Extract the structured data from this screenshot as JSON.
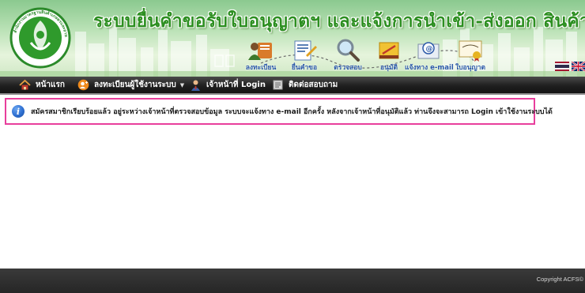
{
  "header": {
    "site_title": "ระบบยื่นคำขอรับใบอนุญาตฯ และแจ้งการนำเข้า-ส่งออก สินค้าเกษตรตามมาตรฐานบังคับ",
    "logo_caption": "สำนักงานมาตรฐานสินค้าเกษตรและอาหารแห่งชาติ",
    "menu_items": [
      {
        "label": "ลงทะเบียน",
        "icon": "register-user-icon"
      },
      {
        "label": "ยื่นคำขอ",
        "icon": "submit-document-icon"
      },
      {
        "label": "ตรวจสอบ",
        "icon": "magnifier-icon"
      },
      {
        "label": "อนุมัติ",
        "icon": "approve-icon"
      },
      {
        "label": "แจ้งทาง e-mail",
        "icon": "email-icon"
      },
      {
        "label": "ใบอนุญาต",
        "icon": "certificate-icon"
      }
    ],
    "languages": [
      "th-flag-icon",
      "uk-flag-icon"
    ]
  },
  "navbar": {
    "items": [
      {
        "label": "หน้าแรก",
        "icon": "home-icon"
      },
      {
        "label": "ลงทะเบียนผู้ใช้งานระบบ",
        "icon": "add-user-icon",
        "has_dropdown": true
      },
      {
        "label": "เจ้าหน้าที่ Login",
        "icon": "officer-icon"
      },
      {
        "label": "ติดต่อสอบถาม",
        "icon": "contact-book-icon"
      }
    ]
  },
  "notice": {
    "icon": "info-icon",
    "text": "สมัครสมาชิกเรียบร้อยแล้ว อยู่ระหว่างเจ้าหน้าที่ตรวจสอบข้อมูล ระบบจะแจ้งทาง e-mail อีกครั้ง หลังจากเจ้าหน้าที่อนุมัติแล้ว ท่านจึงจะสามารถ Login เข้าใช้งานระบบได้",
    "border_color": "#e83e9c"
  },
  "footer": {
    "copyright": "Copyright ACFS©"
  },
  "colors": {
    "title_green": "#2d8f21",
    "menu_blue": "#2a58a8",
    "navbar_dark": "#1f1f1f"
  }
}
